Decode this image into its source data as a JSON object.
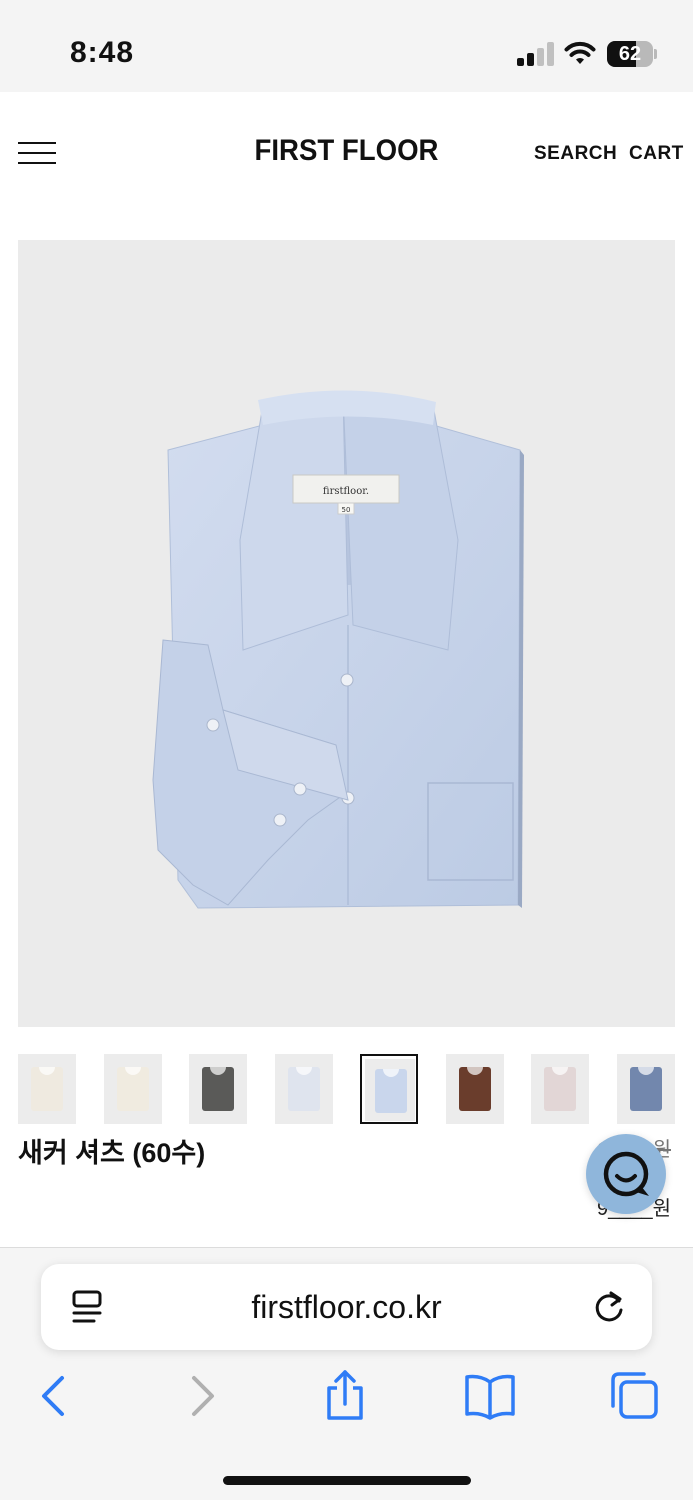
{
  "status_bar": {
    "time": "8:48",
    "battery": "62",
    "battery_level": 0.62
  },
  "header": {
    "logo": "FIRST FLOOR",
    "search_label": "SEARCH",
    "cart_label": "CART"
  },
  "product": {
    "tag_brand": "firstfloor.",
    "tag_size": "50",
    "name": "새커 셔츠 (60수)",
    "original_price": "10___원",
    "sale_price": "9____원",
    "selected_thumbnail": 4,
    "thumbnails": [
      {
        "color": "#efeae0"
      },
      {
        "color": "#f0ebe0"
      },
      {
        "color": "#5a5a58"
      },
      {
        "color": "#dfe4ee"
      },
      {
        "color": "#c9d6ec"
      },
      {
        "color": "#6a3d2c"
      },
      {
        "color": "#e2d6d6"
      },
      {
        "color": "#7287ad"
      }
    ]
  },
  "browser": {
    "url": "firstfloor.co.kr"
  },
  "colors": {
    "accent": "#2f7cf6",
    "chat": "#8fb6db",
    "shirt": "#c8d4ea"
  }
}
